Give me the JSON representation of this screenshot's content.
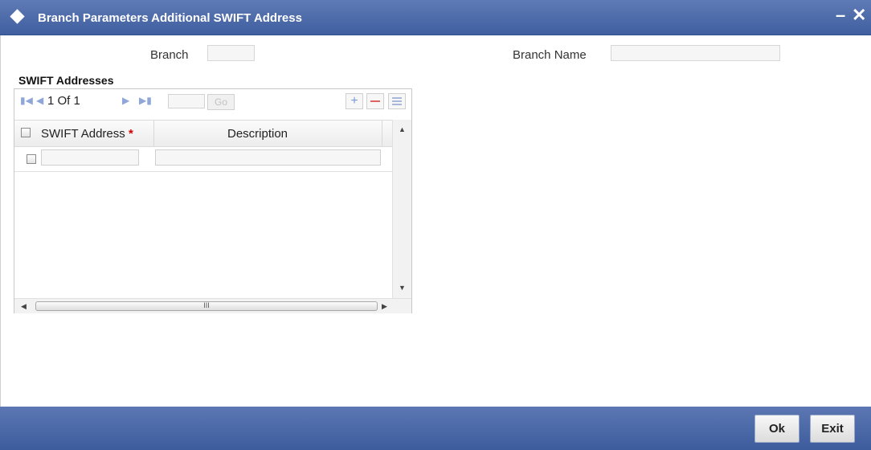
{
  "window": {
    "title": "Branch Parameters Additional SWIFT Address",
    "minimize": "–",
    "close": "✕"
  },
  "form": {
    "branch_label": "Branch",
    "branch_value": "",
    "branch_name_label": "Branch Name",
    "branch_name_value": ""
  },
  "swift_section": {
    "title": "SWIFT Addresses",
    "pager": {
      "text": "1 Of 1",
      "page_input": "",
      "go_label": "Go"
    },
    "columns": [
      "SWIFT Address",
      "Description"
    ],
    "required_marker": "*",
    "rows": [
      {
        "swift_address": "",
        "description": ""
      }
    ],
    "hscroll_grip": "III"
  },
  "buttons": {
    "ok": "Ok",
    "exit": "Exit"
  },
  "colors": {
    "title_bar": "#4a69a8",
    "footer": "#4a69a8",
    "pager_icon": "#8fa6d8",
    "add_icon": "#7c99d6",
    "delete_icon": "#e06464",
    "required": "#d40000"
  }
}
